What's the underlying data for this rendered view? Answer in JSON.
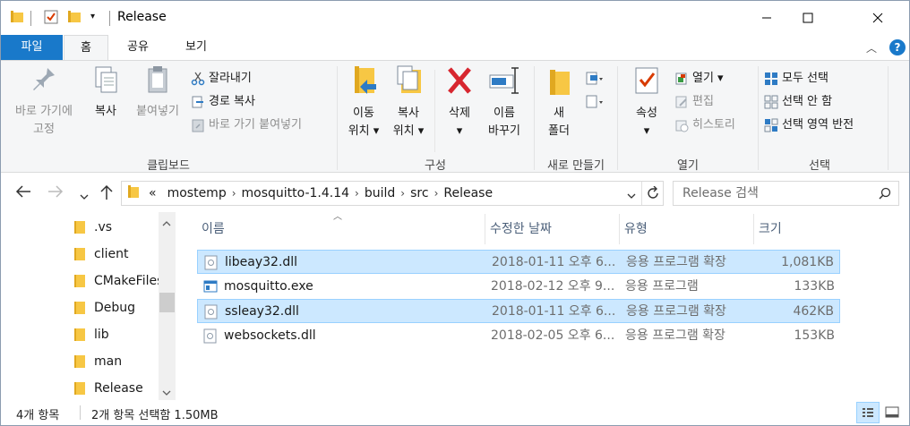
{
  "window": {
    "title": "Release"
  },
  "tabs": {
    "file": "파일",
    "home": "홈",
    "share": "공유",
    "view": "보기"
  },
  "ribbon": {
    "clipboard": {
      "pin_label": "바로 가기에\n고정",
      "copy_label": "복사",
      "paste_label": "붙여넣기",
      "cut_label": "잘라내기",
      "copy_path_label": "경로 복사",
      "paste_shortcut_label": "바로 가기 붙여넣기",
      "group_label": "클립보드"
    },
    "organize": {
      "move_label": "이동\n위치 ▾",
      "copyto_label": "복사\n위치 ▾",
      "delete_label": "삭제\n▾",
      "rename_label": "이름\n바꾸기",
      "group_label": "구성"
    },
    "new": {
      "new_folder_label": "새\n폴더",
      "group_label": "새로 만들기"
    },
    "open": {
      "properties_label": "속성\n▾",
      "open_label": "열기 ▾",
      "edit_label": "편집",
      "history_label": "히스토리",
      "group_label": "열기"
    },
    "select": {
      "select_all": "모두 선택",
      "select_none": "선택 안 함",
      "invert": "선택 영역 반전",
      "group_label": "선택"
    }
  },
  "address": {
    "overflow": "«",
    "crumbs": [
      "mostemp",
      "mosquitto-1.4.14",
      "build",
      "src",
      "Release"
    ],
    "search_placeholder": "Release 검색"
  },
  "nav_pane": {
    "items": [
      ".vs",
      "client",
      "CMakeFiles",
      "Debug",
      "lib",
      "man",
      "Release"
    ]
  },
  "file_list": {
    "columns": {
      "name": "이름",
      "modified": "수정한 날짜",
      "type": "유형",
      "size": "크기"
    },
    "rows": [
      {
        "name": "libeay32.dll",
        "modified": "2018-01-11 오후 6...",
        "type": "응용 프로그램 확장",
        "size": "1,081KB",
        "selected": true
      },
      {
        "name": "mosquitto.exe",
        "modified": "2018-02-12 오후 9...",
        "type": "응용 프로그램",
        "size": "133KB",
        "selected": false
      },
      {
        "name": "ssleay32.dll",
        "modified": "2018-01-11 오후 6...",
        "type": "응용 프로그램 확장",
        "size": "462KB",
        "selected": true
      },
      {
        "name": "websockets.dll",
        "modified": "2018-02-05 오후 6...",
        "type": "응용 프로그램 확장",
        "size": "153KB",
        "selected": false
      }
    ]
  },
  "status": {
    "count": "4개 항목",
    "selection": "2개 항목 선택함 1.50MB"
  },
  "colors": {
    "accent": "#1979ca",
    "selection": "#cce8ff",
    "selection_border": "#99d1ff"
  }
}
